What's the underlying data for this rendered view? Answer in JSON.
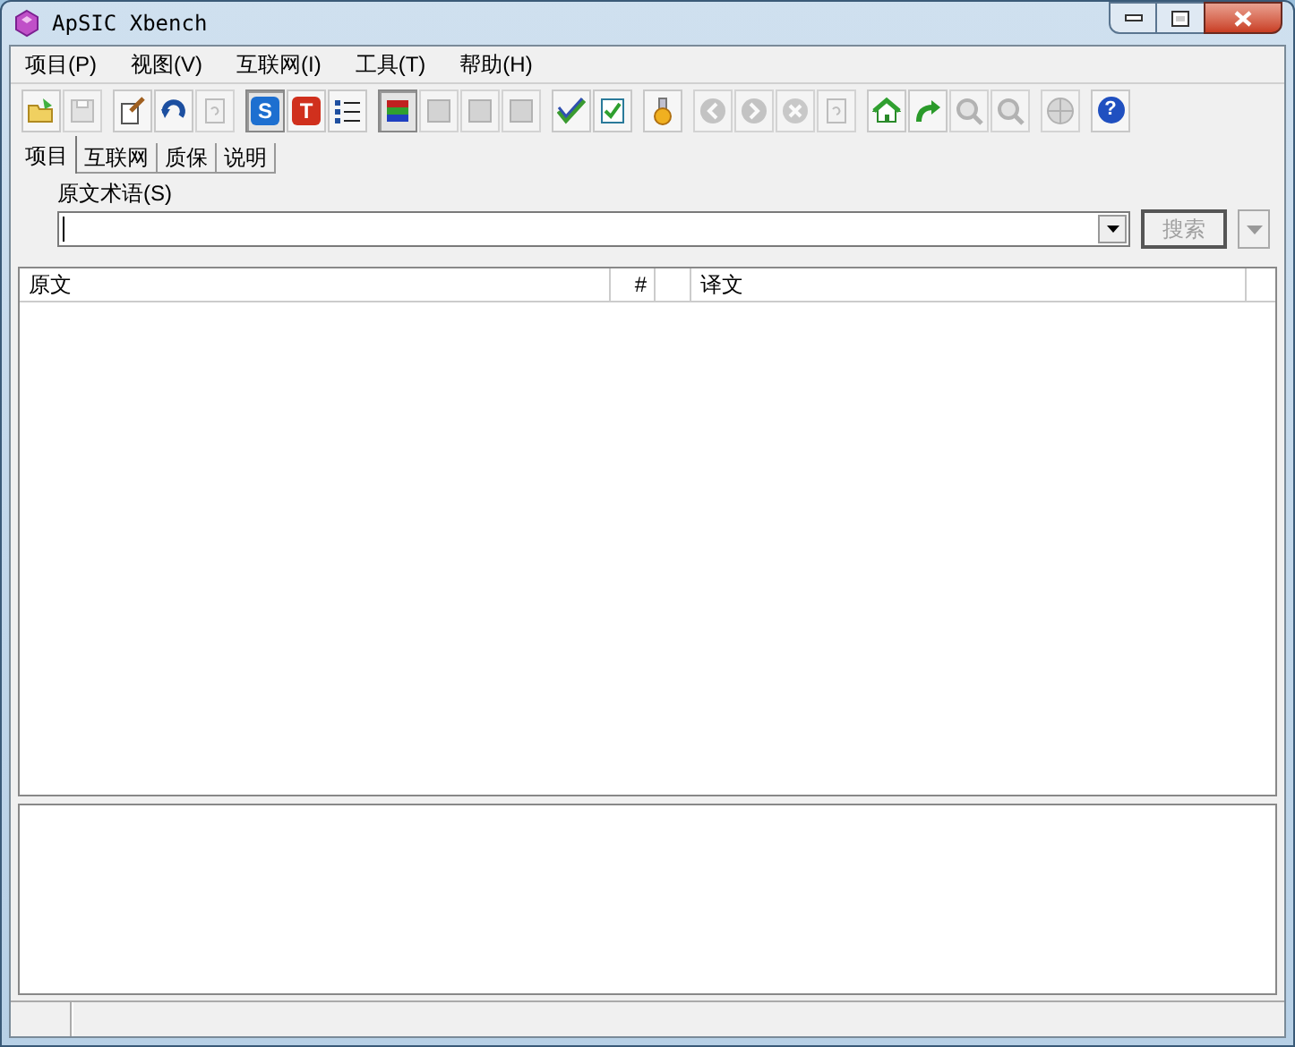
{
  "window": {
    "title": "ApSIC Xbench"
  },
  "menu": [
    "项目(P)",
    "视图(V)",
    "互联网(I)",
    "工具(T)",
    "帮助(H)"
  ],
  "toolbar": [
    [
      {
        "kind": "folder",
        "disabled": false,
        "pressed": false
      },
      {
        "kind": "save",
        "disabled": true,
        "pressed": false
      }
    ],
    [
      {
        "kind": "edit",
        "disabled": false,
        "pressed": false
      },
      {
        "kind": "refresh",
        "disabled": false,
        "pressed": false
      },
      {
        "kind": "page",
        "disabled": true,
        "pressed": false
      }
    ],
    [
      {
        "kind": "letter",
        "text": "S",
        "color": "#1d6fd0",
        "disabled": false,
        "pressed": true
      },
      {
        "kind": "letter",
        "text": "T",
        "color": "#d0301d",
        "disabled": false,
        "pressed": false
      },
      {
        "kind": "list",
        "disabled": false,
        "pressed": false
      }
    ],
    [
      {
        "kind": "bars",
        "disabled": false,
        "pressed": true
      },
      {
        "kind": "square",
        "disabled": true,
        "pressed": false
      },
      {
        "kind": "square",
        "disabled": true,
        "pressed": false
      },
      {
        "kind": "square",
        "disabled": true,
        "pressed": false
      }
    ],
    [
      {
        "kind": "check",
        "disabled": false,
        "pressed": false
      },
      {
        "kind": "checklist",
        "disabled": false,
        "pressed": false
      }
    ],
    [
      {
        "kind": "pin",
        "disabled": false,
        "pressed": false
      }
    ],
    [
      {
        "kind": "back",
        "disabled": true,
        "pressed": false
      },
      {
        "kind": "forward",
        "disabled": true,
        "pressed": false
      },
      {
        "kind": "stop",
        "disabled": true,
        "pressed": false
      },
      {
        "kind": "page",
        "disabled": true,
        "pressed": false
      }
    ],
    [
      {
        "kind": "home",
        "disabled": false,
        "pressed": false
      },
      {
        "kind": "redo",
        "disabled": false,
        "pressed": false
      },
      {
        "kind": "zoom",
        "disabled": true,
        "pressed": false
      },
      {
        "kind": "zoom",
        "disabled": true,
        "pressed": false
      }
    ],
    [
      {
        "kind": "globe",
        "disabled": true,
        "pressed": false
      }
    ],
    [
      {
        "kind": "help",
        "text": "?",
        "disabled": false,
        "pressed": false
      }
    ]
  ],
  "tabs": [
    {
      "label": "项目",
      "selected": true
    },
    {
      "label": "互联网",
      "selected": false
    },
    {
      "label": "质保",
      "selected": false
    },
    {
      "label": "说明",
      "selected": false
    }
  ],
  "search": {
    "label": "原文术语(S)",
    "button": "搜索",
    "button_disabled": true
  },
  "table": {
    "columns": [
      "原文",
      "#",
      "",
      "译文"
    ]
  }
}
